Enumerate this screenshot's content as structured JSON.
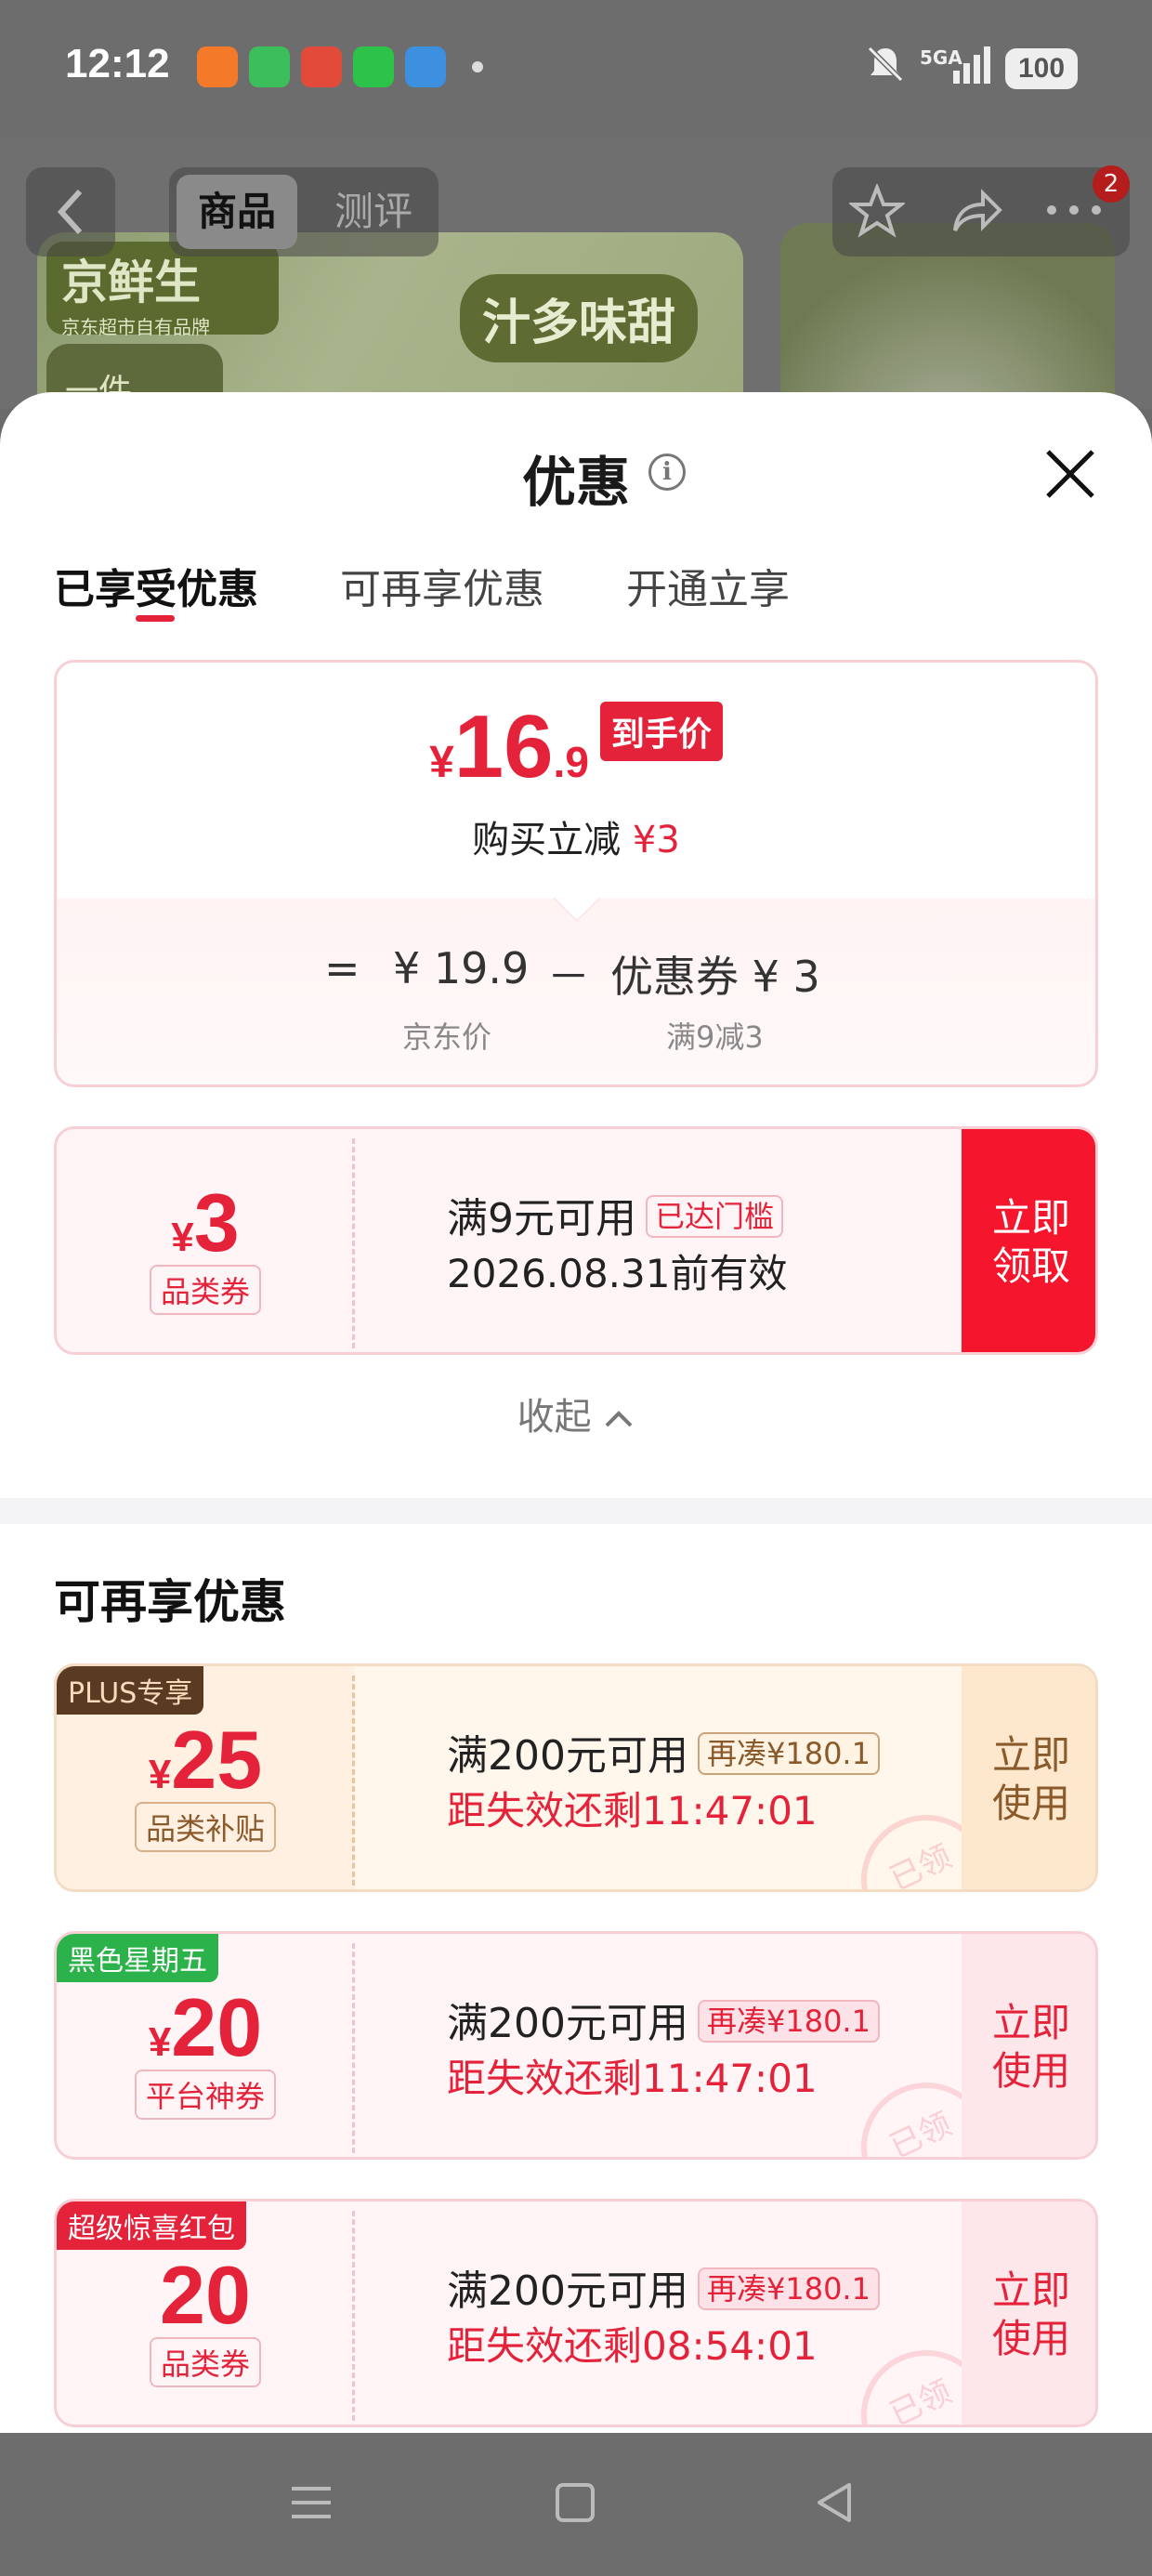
{
  "status_bar": {
    "time": "12:12",
    "network": "5GA",
    "battery": "100"
  },
  "background_page": {
    "tabs": [
      "商品",
      "测评"
    ],
    "brand_badge": "京鲜生",
    "brand_sub": "京东超市自有品牌",
    "slogan": "汁多味甜",
    "tag": "一件",
    "cart_badge": "2"
  },
  "sheet": {
    "title": "优惠",
    "tabs": [
      "已享受优惠",
      "可再享优惠",
      "开通立享"
    ]
  },
  "price_card": {
    "currency": "¥",
    "price_int": "16",
    "price_dec": ".9",
    "price_tag": "到手价",
    "subtitle_prefix": "购买立减",
    "subtitle_amount": "¥3",
    "formula_eq": "=",
    "formula_price": "¥ 19.9",
    "formula_minus": "－",
    "formula_coupon": "优惠券 ¥ 3",
    "label_price": "京东价",
    "label_coupon": "满9减3"
  },
  "coupons_enjoyed": [
    {
      "currency": "¥",
      "amount": "3",
      "type": "品类券",
      "condition": "满9元可用",
      "chip": "已达门槛",
      "line2": "2026.08.31前有效",
      "action": "立即领取"
    }
  ],
  "collapse_label": "收起",
  "more_section_title": "可再享优惠",
  "coupons_more": [
    {
      "corner_tag": "PLUS专享",
      "currency": "¥",
      "amount": "25",
      "type": "品类补贴",
      "condition": "满200元可用",
      "chip": "再凑¥180.1",
      "line2": "距失效还剩11:47:01",
      "action": "立即使用",
      "stamp": "已领"
    },
    {
      "corner_tag": "黑色星期五",
      "currency": "¥",
      "amount": "20",
      "type": "平台神券",
      "condition": "满200元可用",
      "chip": "再凑¥180.1",
      "line2": "距失效还剩11:47:01",
      "action": "立即使用",
      "stamp": "已领"
    },
    {
      "corner_tag": "超级惊喜红包",
      "currency": "",
      "amount": "20",
      "type": "品类券",
      "condition": "满200元可用",
      "chip": "再凑¥180.1",
      "line2": "距失效还剩08:54:01",
      "action": "立即使用",
      "stamp": "已领"
    }
  ],
  "colors": {
    "accent": "#e4223a",
    "plus_tag": "#5a3a22",
    "black_friday_tag": "#2bb24a",
    "surprise_tag": "#e4223a"
  },
  "icons": [
    "back-icon",
    "star-icon",
    "share-icon",
    "more-icon",
    "info-icon",
    "close-icon",
    "chevron-up-icon",
    "menu-nav-icon",
    "home-nav-icon",
    "back-nav-icon"
  ]
}
